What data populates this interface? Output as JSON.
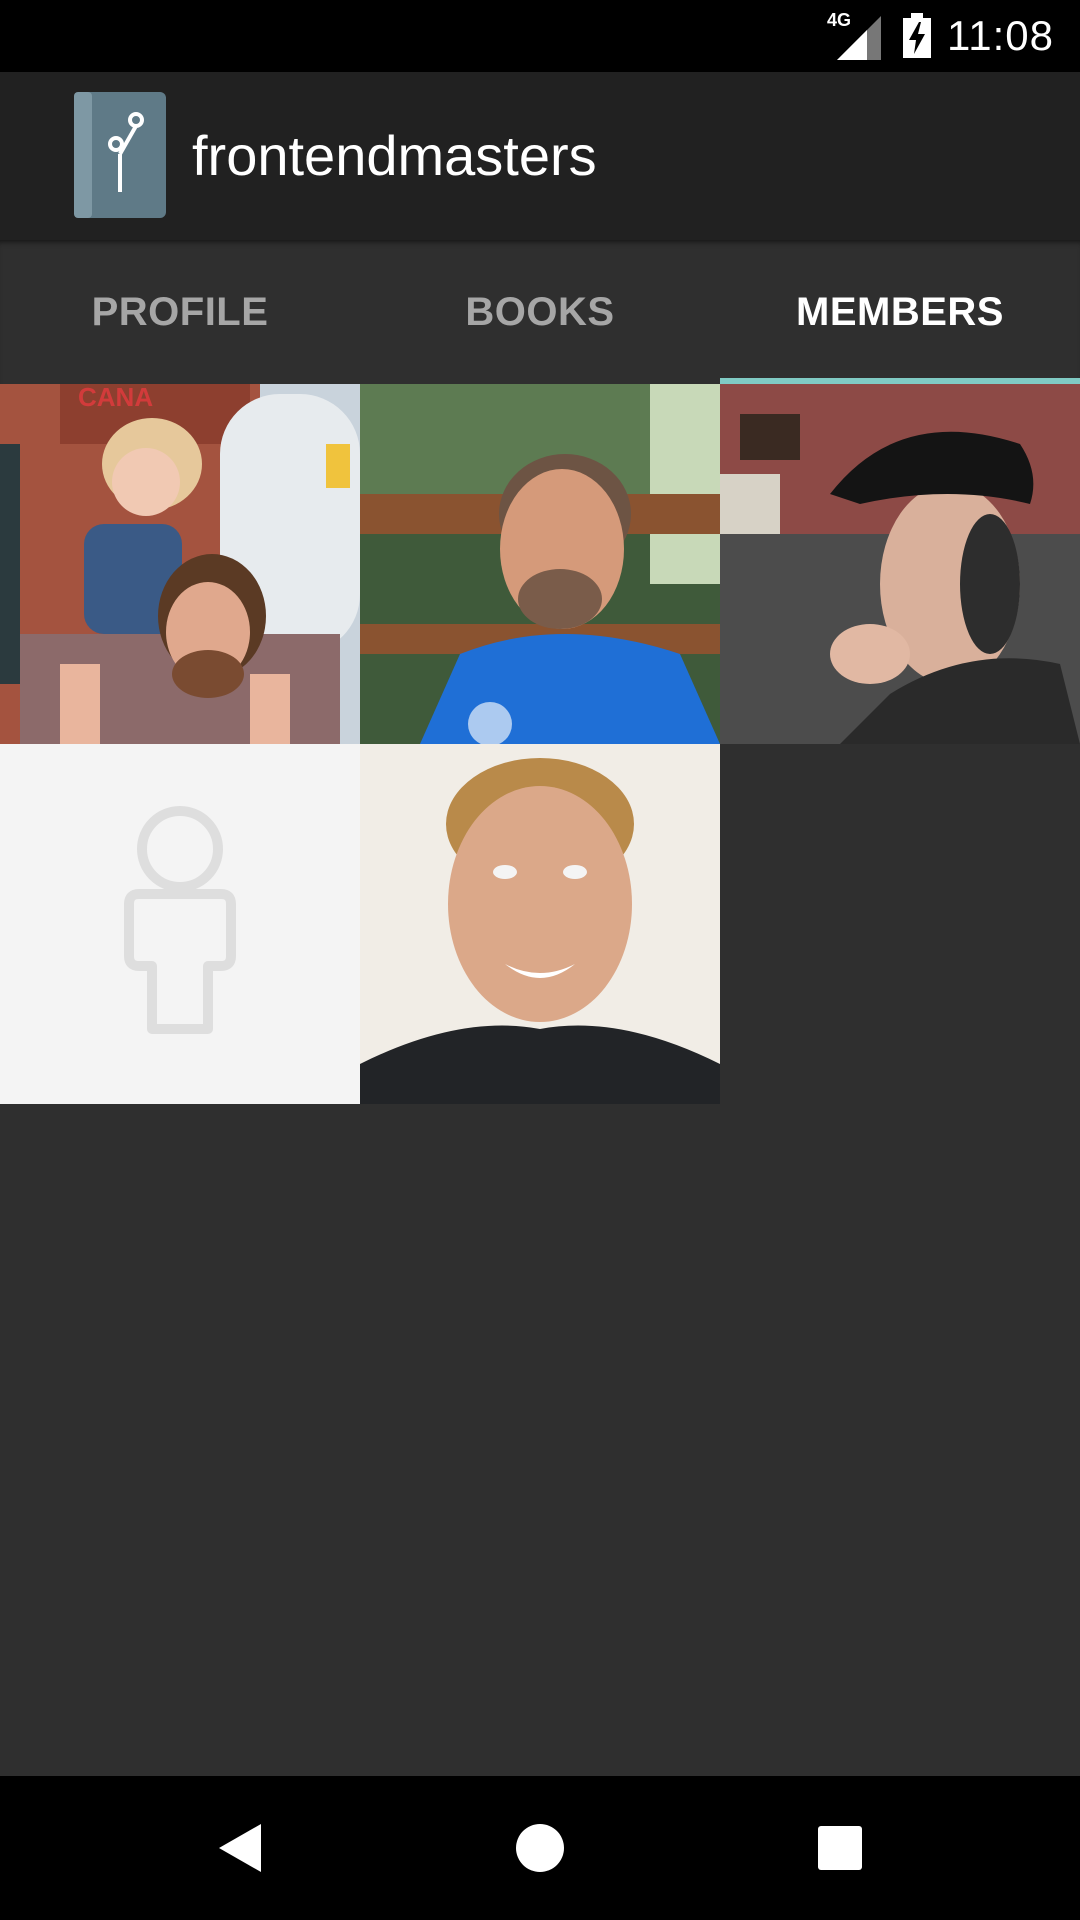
{
  "status_bar": {
    "network_label": "4G",
    "time": "11:08",
    "icons": [
      "signal-icon",
      "battery-charging-icon"
    ]
  },
  "toolbar": {
    "title": "frontendmasters",
    "logo_icon": "git-branch-book-icon"
  },
  "tabs": [
    {
      "label": "PROFILE",
      "active": false
    },
    {
      "label": "BOOKS",
      "active": false
    },
    {
      "label": "MEMBERS",
      "active": true
    }
  ],
  "members": [
    {
      "avatar": "photo-man-with-child-at-brewery"
    },
    {
      "avatar": "photo-man-in-blue-shirt-outdoors"
    },
    {
      "avatar": "photo-man-in-flat-cap"
    },
    {
      "avatar": "default-person-placeholder"
    },
    {
      "avatar": "photo-smiling-blond-man"
    }
  ],
  "nav_bar": {
    "icons": [
      "back-icon",
      "home-icon",
      "recents-icon"
    ]
  },
  "colors": {
    "toolbar": "#212121",
    "background": "#2f2f2f",
    "tab_indicator": "#80cbc4",
    "tab_inactive_text": "#a6a6a6",
    "tab_active_text": "#ffffff"
  }
}
